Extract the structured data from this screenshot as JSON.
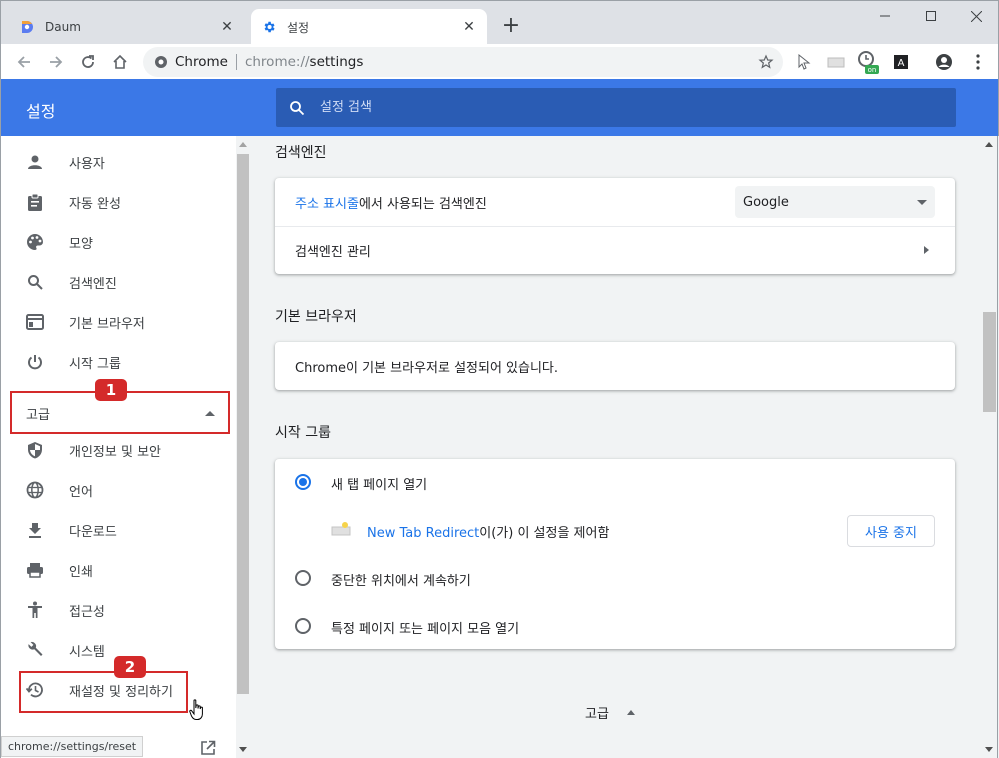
{
  "tabs": [
    {
      "title": "Daum"
    },
    {
      "title": "설정"
    }
  ],
  "toolbar": {
    "site": "Chrome",
    "url_scheme": "chrome://",
    "url_path": "settings",
    "ext_badge": "on"
  },
  "header": {
    "title": "설정",
    "search_placeholder": "설정 검색"
  },
  "sidebar": {
    "items": [
      {
        "label": "사용자",
        "icon": "person-icon"
      },
      {
        "label": "자동 완성",
        "icon": "clipboard-icon"
      },
      {
        "label": "모양",
        "icon": "palette-icon"
      },
      {
        "label": "검색엔진",
        "icon": "search-icon"
      },
      {
        "label": "기본 브라우저",
        "icon": "browser-icon"
      },
      {
        "label": "시작 그룹",
        "icon": "power-icon"
      }
    ],
    "advanced_label": "고급",
    "advanced_items": [
      {
        "label": "개인정보 및 보안",
        "icon": "shield-icon"
      },
      {
        "label": "언어",
        "icon": "globe-icon"
      },
      {
        "label": "다운로드",
        "icon": "download-icon"
      },
      {
        "label": "인쇄",
        "icon": "printer-icon"
      },
      {
        "label": "접근성",
        "icon": "accessibility-icon"
      },
      {
        "label": "시스템",
        "icon": "wrench-icon"
      },
      {
        "label": "재설정 및 정리하기",
        "icon": "restore-icon"
      }
    ],
    "status_url": "chrome://settings/reset"
  },
  "annotations": {
    "badge1": "1",
    "badge2": "2",
    "color": "#d42a2a"
  },
  "main": {
    "search_engine": {
      "title": "검색엔진",
      "row1_link": "주소 표시줄",
      "row1_text": "에서 사용되는 검색엔진",
      "row1_value": "Google",
      "row2_label": "검색엔진 관리"
    },
    "default_browser": {
      "title": "기본 브라우저",
      "text": "Chrome이 기본 브라우저로 설정되어 있습니다."
    },
    "startup": {
      "title": "시작 그룹",
      "options": [
        {
          "label": "새 탭 페이지 열기",
          "checked": true
        },
        {
          "label": "중단한 위치에서 계속하기",
          "checked": false
        },
        {
          "label": "특정 페이지 또는 페이지 모음 열기",
          "checked": false
        }
      ],
      "ext_link": "New Tab Redirect",
      "ext_text": "이(가) 이 설정을 제어함",
      "disable_button": "사용 중지"
    },
    "advanced_footer": "고급"
  },
  "colors": {
    "header": "#3b78e7",
    "search": "#2a5cb4",
    "accent": "#1a73e8"
  }
}
